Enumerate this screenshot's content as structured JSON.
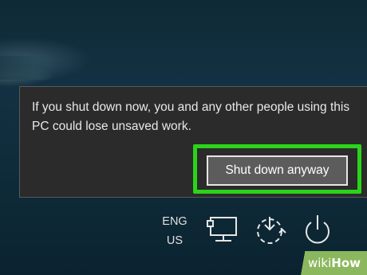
{
  "dialog": {
    "message": "If you shut down now, you and any other people using this PC could lose unsaved work.",
    "confirm_label": "Shut down anyway"
  },
  "taskbar": {
    "language_line1": "ENG",
    "language_line2": "US",
    "icons": [
      "network-icon",
      "sync-icon",
      "power-icon"
    ]
  },
  "watermark": {
    "prefix": "wiki",
    "suffix": "How"
  },
  "colors": {
    "highlight": "#2bd41a",
    "dialog_bg": "#2b2b2b",
    "button_bg": "#5c5c5c"
  }
}
